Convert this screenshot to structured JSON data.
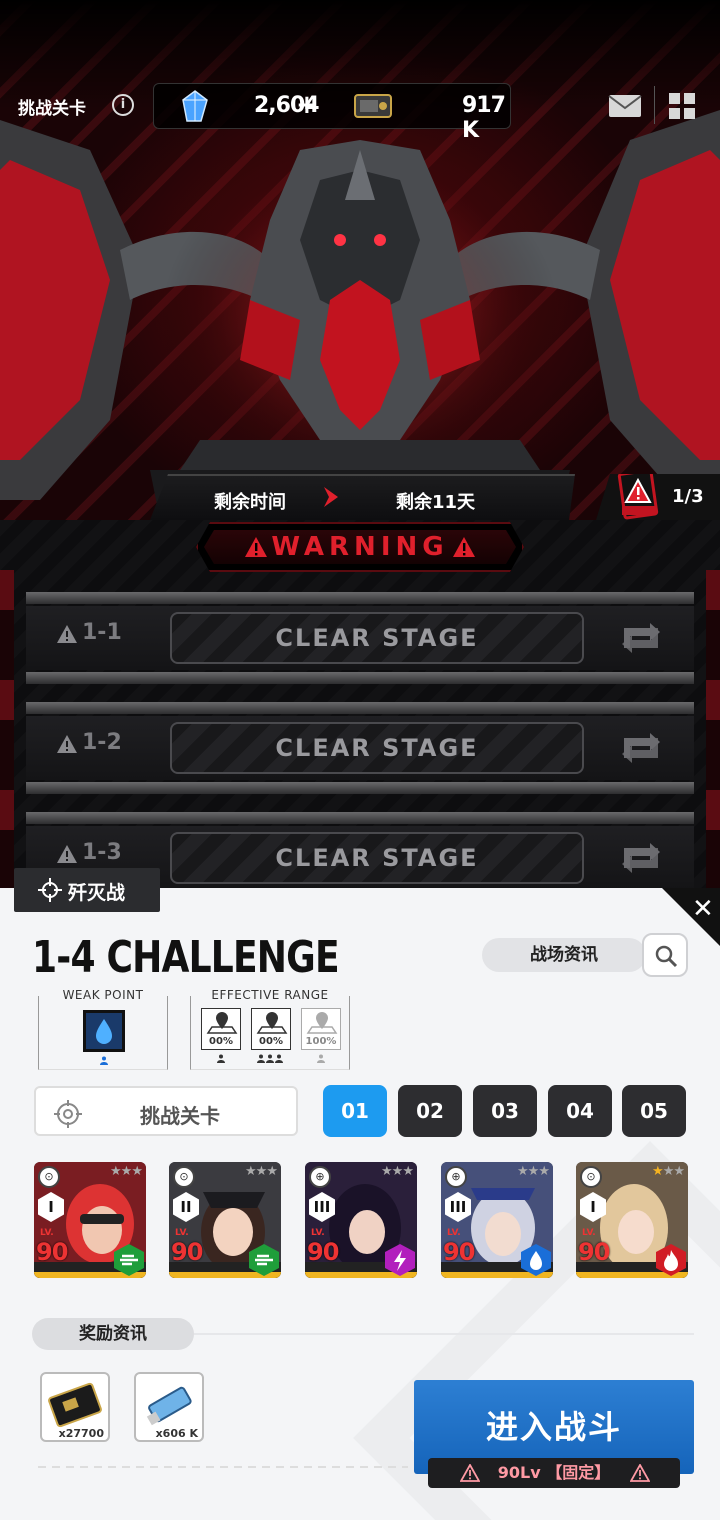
{
  "topbar": {
    "title": "挑战关卡",
    "info_icon": "info-icon",
    "gems": "2,604",
    "gems_plus": "+",
    "tickets": "917 K"
  },
  "timer": {
    "label": "剩余时间",
    "value": "剩余11天"
  },
  "danger": {
    "count": "1/3",
    "badge": "DANGER"
  },
  "warning": "WARNING",
  "stages": [
    {
      "id": "1-1",
      "label": "CLEAR STAGE"
    },
    {
      "id": "1-2",
      "label": "CLEAR STAGE"
    },
    {
      "id": "1-3",
      "label": "CLEAR STAGE"
    }
  ],
  "panel": {
    "mode_label": "歼灭战",
    "title": "1-4 CHALLENGE",
    "intel_label": "战场资讯",
    "weak_point_label": "WEAK  POINT",
    "effective_range_label": "EFFECTIVE RANGE",
    "ranges": [
      {
        "pct": "00%",
        "people": "1"
      },
      {
        "pct": "00%",
        "people": "3"
      },
      {
        "pct": "100%",
        "people": "1"
      }
    ],
    "stage_select_label": "挑战关卡",
    "tabs": [
      "01",
      "02",
      "03",
      "04",
      "05"
    ],
    "active_tab": "01"
  },
  "team": [
    {
      "rank": "I",
      "level": "90",
      "element": "wind",
      "lvtag": "LV."
    },
    {
      "rank": "II",
      "level": "90",
      "element": "wind",
      "lvtag": "LV."
    },
    {
      "rank": "III",
      "level": "90",
      "element": "electric",
      "lvtag": "LV."
    },
    {
      "rank": "III",
      "level": "90",
      "element": "water",
      "lvtag": "LV."
    },
    {
      "rank": "I",
      "level": "90",
      "element": "fire",
      "lvtag": "LV."
    }
  ],
  "rewards": {
    "label": "奖励资讯",
    "items": [
      {
        "icon": "credit-card-icon",
        "qty": "x27700"
      },
      {
        "icon": "usb-core-icon",
        "qty": "x606 K"
      }
    ]
  },
  "enter": {
    "label": "进入战斗",
    "sub": "90Lv 【固定】"
  },
  "colors": {
    "accent_blue": "#1d9bf0",
    "warning_red": "#e0202c",
    "enter_blue": "#1f6fc6"
  }
}
